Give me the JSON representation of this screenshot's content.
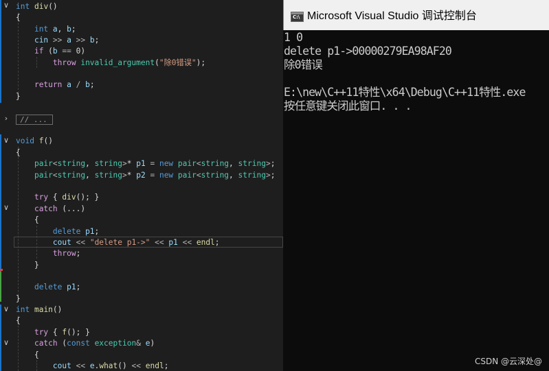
{
  "editor": {
    "collapsed_region_label": "// ...",
    "lines": [
      [
        [
          "kw",
          "int"
        ],
        [
          "pl",
          " "
        ],
        [
          "fn",
          "div"
        ],
        [
          "pl",
          "()"
        ]
      ],
      [
        [
          "pl",
          "{"
        ]
      ],
      [
        [
          "pl",
          "    "
        ],
        [
          "kw",
          "int"
        ],
        [
          "pl",
          " "
        ],
        [
          "id",
          "a"
        ],
        [
          "pl",
          ", "
        ],
        [
          "id",
          "b"
        ],
        [
          "pl",
          ";"
        ]
      ],
      [
        [
          "pl",
          "    "
        ],
        [
          "id",
          "cin"
        ],
        [
          "pl",
          " "
        ],
        [
          "op",
          ">>"
        ],
        [
          "pl",
          " "
        ],
        [
          "id",
          "a"
        ],
        [
          "pl",
          " "
        ],
        [
          "op",
          ">>"
        ],
        [
          "pl",
          " "
        ],
        [
          "id",
          "b"
        ],
        [
          "pl",
          ";"
        ]
      ],
      [
        [
          "pl",
          "    "
        ],
        [
          "ctl",
          "if"
        ],
        [
          "pl",
          " ("
        ],
        [
          "id",
          "b"
        ],
        [
          "pl",
          " "
        ],
        [
          "op",
          "=="
        ],
        [
          "pl",
          " 0)"
        ]
      ],
      [
        [
          "pl",
          "        "
        ],
        [
          "ctl",
          "throw"
        ],
        [
          "pl",
          " "
        ],
        [
          "ty",
          "invalid_argument"
        ],
        [
          "pl",
          "("
        ],
        [
          "str",
          "\"除0错误\""
        ],
        [
          "pl",
          ");"
        ]
      ],
      [
        [
          "pl",
          ""
        ]
      ],
      [
        [
          "pl",
          "    "
        ],
        [
          "ctl",
          "return"
        ],
        [
          "pl",
          " "
        ],
        [
          "id",
          "a"
        ],
        [
          "pl",
          " "
        ],
        [
          "op",
          "/"
        ],
        [
          "pl",
          " "
        ],
        [
          "id",
          "b"
        ],
        [
          "pl",
          ";"
        ]
      ],
      [
        [
          "pl",
          "}"
        ]
      ],
      [
        [
          "pl",
          ""
        ]
      ],
      [
        [
          "pl",
          ""
        ]
      ],
      [
        [
          "pl",
          ""
        ]
      ],
      [
        [
          "kw",
          "void"
        ],
        [
          "pl",
          " "
        ],
        [
          "fn",
          "f"
        ],
        [
          "pl",
          "()"
        ]
      ],
      [
        [
          "pl",
          "{"
        ]
      ],
      [
        [
          "pl",
          "    "
        ],
        [
          "ty",
          "pair"
        ],
        [
          "op",
          "<"
        ],
        [
          "ty",
          "string"
        ],
        [
          "pl",
          ", "
        ],
        [
          "ty",
          "string"
        ],
        [
          "op",
          ">"
        ],
        [
          "pl",
          "* "
        ],
        [
          "id",
          "p1"
        ],
        [
          "pl",
          " "
        ],
        [
          "op",
          "="
        ],
        [
          "pl",
          " "
        ],
        [
          "kw",
          "new"
        ],
        [
          "pl",
          " "
        ],
        [
          "ty",
          "pair"
        ],
        [
          "op",
          "<"
        ],
        [
          "ty",
          "string"
        ],
        [
          "pl",
          ", "
        ],
        [
          "ty",
          "string"
        ],
        [
          "op",
          ">"
        ],
        [
          "pl",
          ";"
        ]
      ],
      [
        [
          "pl",
          "    "
        ],
        [
          "ty",
          "pair"
        ],
        [
          "op",
          "<"
        ],
        [
          "ty",
          "string"
        ],
        [
          "pl",
          ", "
        ],
        [
          "ty",
          "string"
        ],
        [
          "op",
          ">"
        ],
        [
          "pl",
          "* "
        ],
        [
          "id",
          "p2"
        ],
        [
          "pl",
          " "
        ],
        [
          "op",
          "="
        ],
        [
          "pl",
          " "
        ],
        [
          "kw",
          "new"
        ],
        [
          "pl",
          " "
        ],
        [
          "ty",
          "pair"
        ],
        [
          "op",
          "<"
        ],
        [
          "ty",
          "string"
        ],
        [
          "pl",
          ", "
        ],
        [
          "ty",
          "string"
        ],
        [
          "op",
          ">"
        ],
        [
          "pl",
          ";"
        ]
      ],
      [
        [
          "pl",
          ""
        ]
      ],
      [
        [
          "pl",
          "    "
        ],
        [
          "ctl",
          "try"
        ],
        [
          "pl",
          " { "
        ],
        [
          "fn",
          "div"
        ],
        [
          "pl",
          "(); }"
        ]
      ],
      [
        [
          "pl",
          "    "
        ],
        [
          "ctl",
          "catch"
        ],
        [
          "pl",
          " (...)"
        ]
      ],
      [
        [
          "pl",
          "    {"
        ]
      ],
      [
        [
          "pl",
          "        "
        ],
        [
          "kw",
          "delete"
        ],
        [
          "pl",
          " "
        ],
        [
          "id",
          "p1"
        ],
        [
          "pl",
          ";"
        ]
      ],
      [
        [
          "pl",
          "        "
        ],
        [
          "id",
          "cout"
        ],
        [
          "pl",
          " "
        ],
        [
          "op",
          "<<"
        ],
        [
          "pl",
          " "
        ],
        [
          "str",
          "\"delete p1->\""
        ],
        [
          "pl",
          " "
        ],
        [
          "op",
          "<<"
        ],
        [
          "pl",
          " "
        ],
        [
          "id",
          "p1"
        ],
        [
          "pl",
          " "
        ],
        [
          "op",
          "<<"
        ],
        [
          "pl",
          " "
        ],
        [
          "fn",
          "endl"
        ],
        [
          "pl",
          ";"
        ]
      ],
      [
        [
          "pl",
          "        "
        ],
        [
          "ctl",
          "throw"
        ],
        [
          "pl",
          ";"
        ]
      ],
      [
        [
          "pl",
          "    }"
        ]
      ],
      [
        [
          "pl",
          ""
        ]
      ],
      [
        [
          "pl",
          "    "
        ],
        [
          "kw",
          "delete"
        ],
        [
          "pl",
          " "
        ],
        [
          "id",
          "p1"
        ],
        [
          "pl",
          ";"
        ]
      ],
      [
        [
          "pl",
          "}"
        ]
      ],
      [
        [
          "kw",
          "int"
        ],
        [
          "pl",
          " "
        ],
        [
          "fn",
          "main"
        ],
        [
          "pl",
          "()"
        ]
      ],
      [
        [
          "pl",
          "{"
        ]
      ],
      [
        [
          "pl",
          "    "
        ],
        [
          "ctl",
          "try"
        ],
        [
          "pl",
          " { "
        ],
        [
          "fn",
          "f"
        ],
        [
          "pl",
          "(); }"
        ]
      ],
      [
        [
          "pl",
          "    "
        ],
        [
          "ctl",
          "catch"
        ],
        [
          "pl",
          " ("
        ],
        [
          "kw",
          "const"
        ],
        [
          "pl",
          " "
        ],
        [
          "ty",
          "exception"
        ],
        [
          "op",
          "&"
        ],
        [
          "pl",
          " "
        ],
        [
          "id",
          "e"
        ],
        [
          "pl",
          ")"
        ]
      ],
      [
        [
          "pl",
          "    {"
        ]
      ],
      [
        [
          "pl",
          "        "
        ],
        [
          "id",
          "cout"
        ],
        [
          "pl",
          " "
        ],
        [
          "op",
          "<<"
        ],
        [
          "pl",
          " "
        ],
        [
          "id",
          "e"
        ],
        [
          "pl",
          "."
        ],
        [
          "fn",
          "what"
        ],
        [
          "pl",
          "() "
        ],
        [
          "op",
          "<<"
        ],
        [
          "pl",
          " "
        ],
        [
          "fn",
          "endl"
        ],
        [
          "pl",
          ";"
        ]
      ]
    ]
  },
  "console": {
    "title": "Microsoft Visual Studio 调试控制台",
    "icon_label": "C:\\",
    "output_lines": [
      "1 0",
      "delete p1->00000279EA98AF20",
      "除0错误",
      "",
      "E:\\new\\C++11特性\\x64\\Debug\\C++11特性.exe",
      "按任意键关闭此窗口. . ."
    ]
  },
  "watermark": "CSDN @云深处@"
}
